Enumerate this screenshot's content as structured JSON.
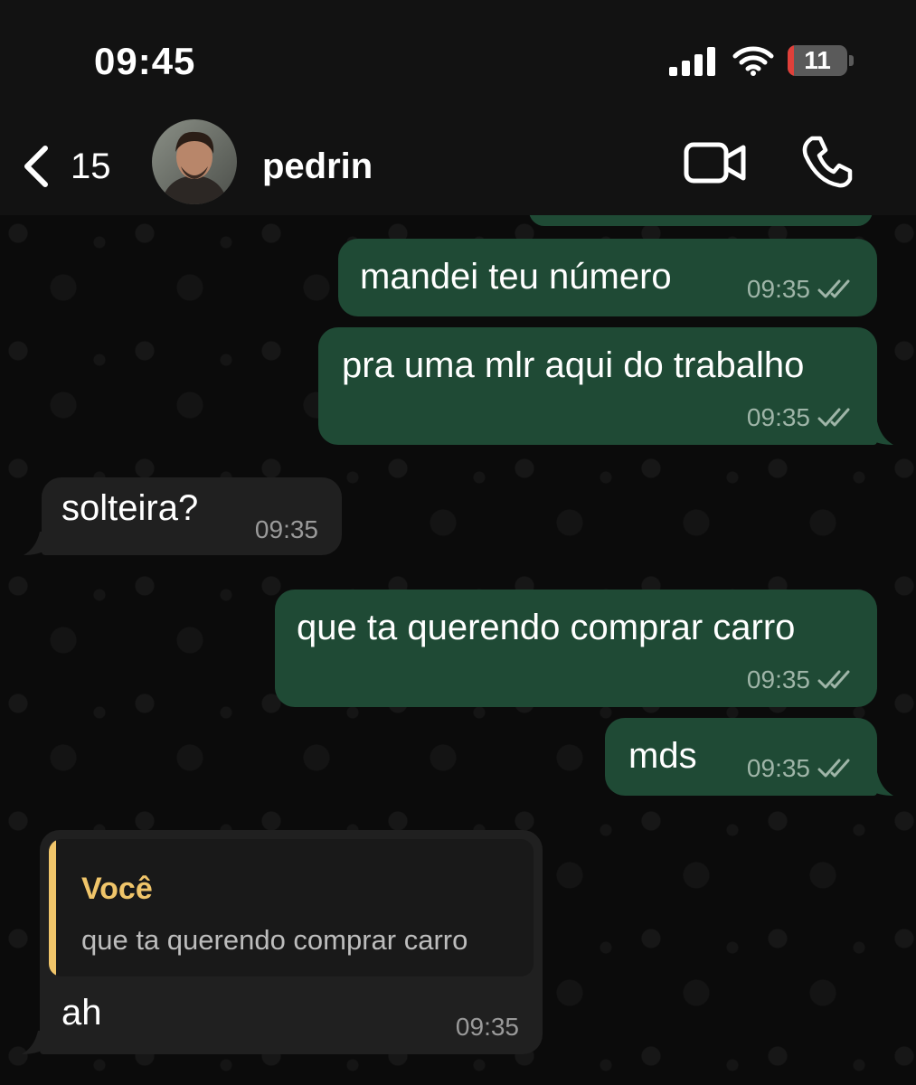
{
  "status_bar": {
    "time": "09:45",
    "battery_level": "11",
    "battery_fraction": 0.11
  },
  "header": {
    "back_count": "15",
    "contact_name": "pedrin"
  },
  "messages": [
    {
      "direction": "out",
      "text": "mandei teu número",
      "time": "09:35",
      "status": "read"
    },
    {
      "direction": "out",
      "text": "pra uma mlr aqui do trabalho",
      "time": "09:35",
      "status": "read"
    },
    {
      "direction": "in",
      "text": "solteira?",
      "time": "09:35"
    },
    {
      "direction": "out",
      "text": "que ta querendo comprar carro",
      "time": "09:35",
      "status": "read"
    },
    {
      "direction": "out",
      "text": "mds",
      "time": "09:35",
      "status": "read"
    },
    {
      "direction": "in",
      "text": "ah",
      "time": "09:35",
      "reply_to": {
        "author": "Você",
        "text": "que ta querendo comprar carro"
      }
    }
  ],
  "colors": {
    "outgoing_bubble": "#1f4a35",
    "incoming_bubble": "#202020",
    "quote_accent": "#f0c56a",
    "background": "#0b0b0b",
    "battery_low": "#e0403a"
  },
  "icons": [
    "back-chevron-icon",
    "video-camera-icon",
    "phone-icon",
    "signal-bars-icon",
    "wifi-icon",
    "battery-icon",
    "double-check-icon"
  ]
}
